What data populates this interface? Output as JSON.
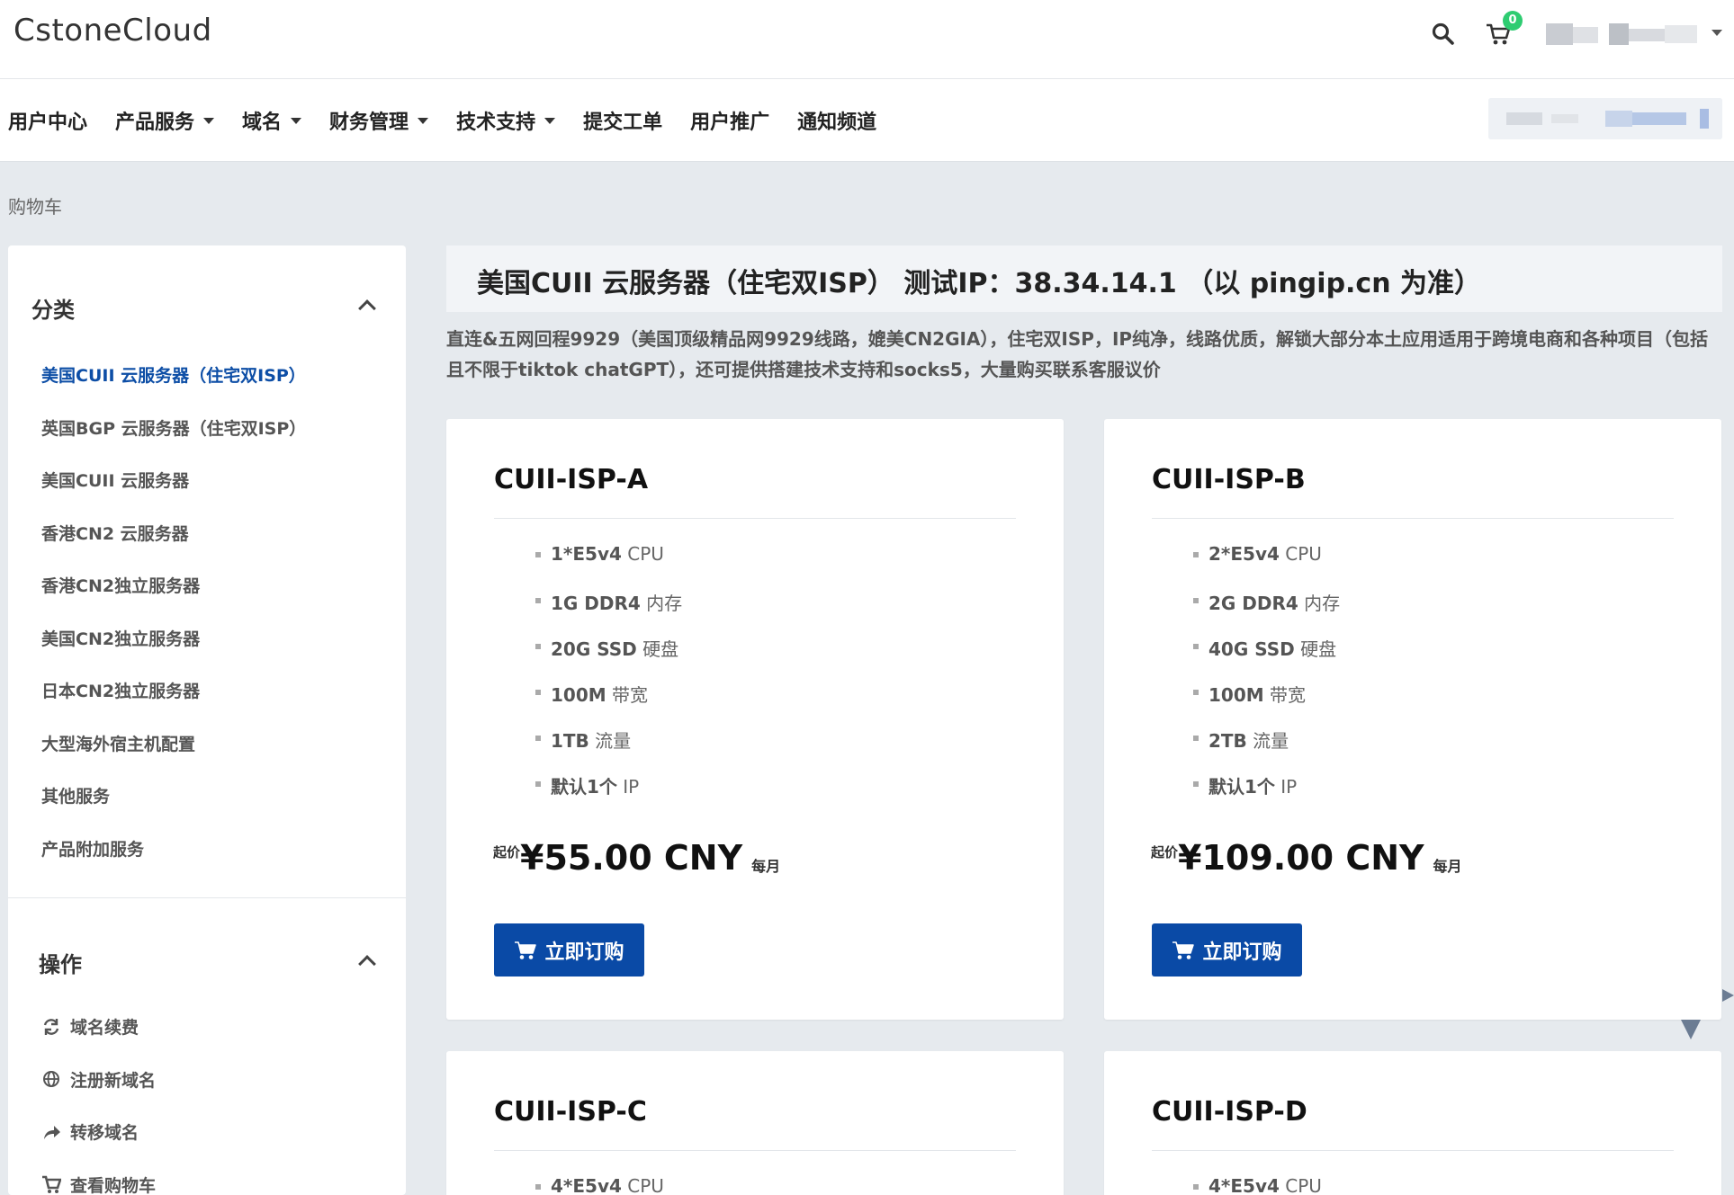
{
  "header": {
    "brand": "CstoneCloud",
    "cart_count": "0"
  },
  "nav": {
    "items": [
      {
        "label": "用户中心",
        "dropdown": false
      },
      {
        "label": "产品服务",
        "dropdown": true
      },
      {
        "label": "域名",
        "dropdown": true
      },
      {
        "label": "财务管理",
        "dropdown": true
      },
      {
        "label": "技术支持",
        "dropdown": true
      },
      {
        "label": "提交工单",
        "dropdown": false
      },
      {
        "label": "用户推广",
        "dropdown": false
      },
      {
        "label": "通知频道",
        "dropdown": false
      }
    ]
  },
  "breadcrumb": "购物车",
  "sidebar": {
    "categories_title": "分类",
    "categories": [
      {
        "label": "美国CUII 云服务器（住宅双ISP）",
        "active": true
      },
      {
        "label": "英国BGP 云服务器（住宅双ISP）",
        "active": false
      },
      {
        "label": "美国CUII 云服务器",
        "active": false
      },
      {
        "label": "香港CN2 云服务器",
        "active": false
      },
      {
        "label": "香港CN2独立服务器",
        "active": false
      },
      {
        "label": "美国CN2独立服务器",
        "active": false
      },
      {
        "label": "日本CN2独立服务器",
        "active": false
      },
      {
        "label": "大型海外宿主机配置",
        "active": false
      },
      {
        "label": "其他服务",
        "active": false
      },
      {
        "label": "产品附加服务",
        "active": false
      }
    ],
    "actions_title": "操作",
    "actions": [
      {
        "label": "域名续费",
        "icon": "refresh-icon"
      },
      {
        "label": "注册新域名",
        "icon": "globe-icon"
      },
      {
        "label": "转移域名",
        "icon": "share-arrow-icon"
      },
      {
        "label": "查看购物车",
        "icon": "cart-icon"
      }
    ]
  },
  "category": {
    "title": "美国CUII 云服务器（住宅双ISP） 测试IP：38.34.14.1 （以 pingip.cn 为准）",
    "description": "直连&五网回程9929（美国顶级精品网9929线路，媲美CN2GIA），住宅双ISP，IP纯净，线路优质，解锁大部分本土应用适用于跨境电商和各种项目（包括且不限于tiktok chatGPT），还可提供搭建技术支持和socks5，大量购买联系客服议价"
  },
  "products": [
    {
      "name": "CUII-ISP-A",
      "features": [
        {
          "value": "1*E5v4",
          "unit": " CPU"
        },
        {
          "value": "1G DDR4",
          "unit": " 内存"
        },
        {
          "value": "20G SSD",
          "unit": " 硬盘"
        },
        {
          "value": "100M",
          "unit": " 带宽"
        },
        {
          "value": "1TB",
          "unit": " 流量"
        },
        {
          "value": "默认1个",
          "unit": " IP"
        }
      ],
      "price_prefix": "起价",
      "price": "¥55.00 CNY",
      "period": "每月",
      "button": "立即订购"
    },
    {
      "name": "CUII-ISP-B",
      "features": [
        {
          "value": "2*E5v4",
          "unit": " CPU"
        },
        {
          "value": "2G DDR4",
          "unit": " 内存"
        },
        {
          "value": "40G SSD",
          "unit": " 硬盘"
        },
        {
          "value": "100M",
          "unit": " 带宽"
        },
        {
          "value": "2TB",
          "unit": " 流量"
        },
        {
          "value": "默认1个",
          "unit": " IP"
        }
      ],
      "price_prefix": "起价",
      "price": "¥109.00 CNY",
      "period": "每月",
      "button": "立即订购"
    },
    {
      "name": "CUII-ISP-C",
      "features": [
        {
          "value": "4*E5v4",
          "unit": " CPU"
        }
      ]
    },
    {
      "name": "CUII-ISP-D",
      "features": [
        {
          "value": "4*E5v4",
          "unit": " CPU"
        }
      ]
    }
  ]
}
